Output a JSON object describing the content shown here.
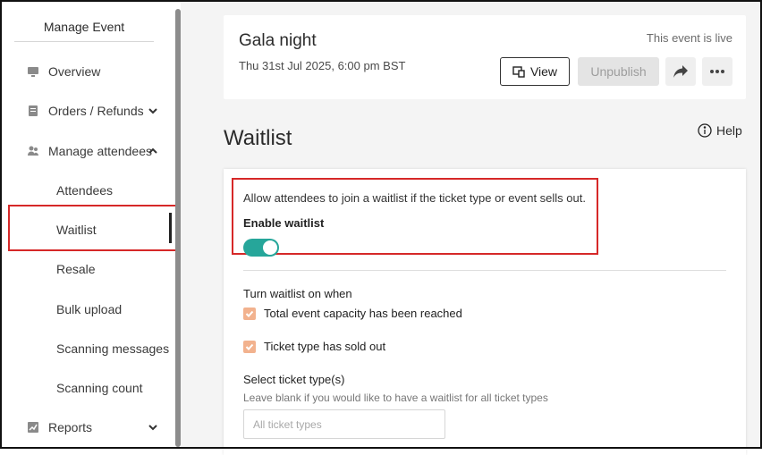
{
  "sidebar": {
    "title": "Manage Event",
    "items": [
      {
        "label": "Overview",
        "icon": "monitor-icon"
      },
      {
        "label": "Orders / Refunds",
        "icon": "document-icon"
      },
      {
        "label": "Manage attendees",
        "icon": "people-icon"
      },
      {
        "label": "Reports",
        "icon": "chart-icon"
      }
    ],
    "sub_items": [
      "Attendees",
      "Waitlist",
      "Resale",
      "Bulk upload",
      "Scanning messages",
      "Scanning count"
    ],
    "active": "Waitlist"
  },
  "event": {
    "title": "Gala night",
    "date": "Thu 31st Jul 2025, 6:00 pm BST",
    "status": "This event is live",
    "view_label": "View",
    "unpublish_label": "Unpublish"
  },
  "page": {
    "title": "Waitlist",
    "help_label": "Help"
  },
  "waitlist": {
    "description": "Allow attendees to join a waitlist if the ticket type or event sells out.",
    "enable_label": "Enable waitlist",
    "enabled": true,
    "turn_on_label": "Turn waitlist on when",
    "conditions": [
      {
        "label": "Total event capacity has been reached",
        "checked": true
      },
      {
        "label": "Ticket type has sold out",
        "checked": true
      }
    ],
    "select_label": "Select ticket type(s)",
    "select_hint": "Leave blank if you would like to have a waitlist for all ticket types",
    "select_placeholder": "All ticket types"
  },
  "colors": {
    "toggle_on": "#26a69a",
    "checkbox": "#f2b28e",
    "highlight": "#d62828",
    "background": "#f4f4f4"
  }
}
